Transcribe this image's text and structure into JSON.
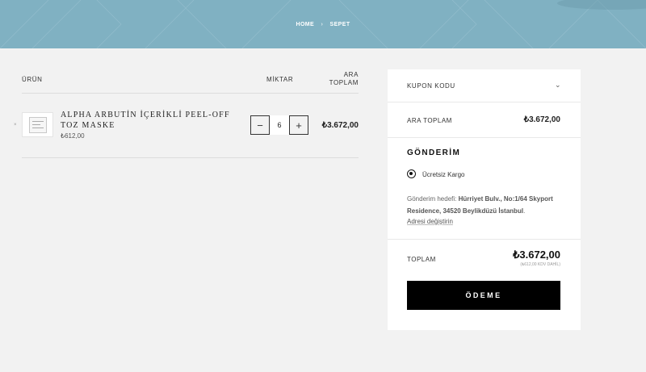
{
  "breadcrumb": {
    "home": "HOME",
    "separator": "›",
    "current": "SEPET"
  },
  "cart_table": {
    "headers": {
      "product": "ÜRÜN",
      "quantity": "MİKTAR",
      "subtotal_line1": "ARA",
      "subtotal_line2": "TOPLAM"
    },
    "items": [
      {
        "name": "ALPHA ARBUTİN İÇERİKLİ PEEL-OFF TOZ MASKE",
        "unit_price": "₺612,00",
        "quantity": "6",
        "line_total": "₺3.672,00",
        "minus": "−",
        "plus": "+",
        "remove": "×"
      }
    ]
  },
  "summary": {
    "coupon_label": "KUPON KODU",
    "coupon_chevron": "⌄",
    "subtotal_label": "ARA TOPLAM",
    "subtotal_value": "₺3.672,00",
    "shipping_title": "GÖNDERİM",
    "shipping_option": "Ücretsiz Kargo",
    "shipping_dest_prefix": "Gönderim hedefi: ",
    "shipping_dest_address": "Hürriyet Bulv., No:1/64 Skyport Residence, 34520 Beylikdüzü İstanbul",
    "shipping_dest_suffix": ".",
    "change_address": "Adresi değiştirin",
    "total_label": "TOPLAM",
    "total_value": "₺3.672,00",
    "tax_note": "(₺612,00 KDV DAHİL)",
    "pay_button": "ÖDEME"
  },
  "colors": {
    "hero": "#80b1c2",
    "background": "#f2f2f2",
    "button": "#000000"
  }
}
